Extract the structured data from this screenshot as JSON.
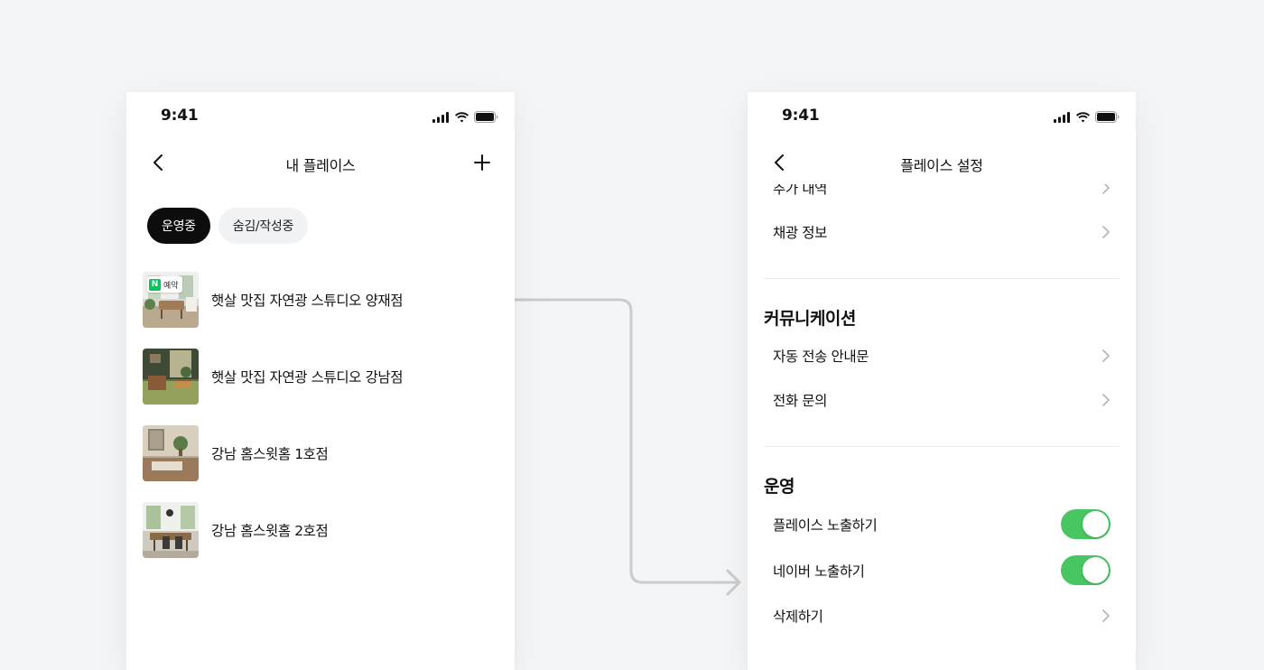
{
  "colors": {
    "background": "#f3f5f7",
    "toggle_on": "#48c662",
    "naver_green": "#03c75a",
    "connector": "#c8c8c8"
  },
  "left_screen": {
    "status_time": "9:41",
    "nav": {
      "back_icon": "chevron-left-icon",
      "title": "내 플레이스",
      "add_icon": "plus-icon"
    },
    "tabs": [
      {
        "label": "운영중",
        "active": true
      },
      {
        "label": "숨김/작성중",
        "active": false
      }
    ],
    "places": [
      {
        "name": "햇살 맛집 자연광 스튜디오 양재점",
        "badge_logo": "N",
        "badge_label": "예약"
      },
      {
        "name": "햇살 맛집 자연광 스튜디오 강남점"
      },
      {
        "name": "강남 홈스윗홈 1호점"
      },
      {
        "name": "강남 홈스윗홈 2호점"
      }
    ]
  },
  "right_screen": {
    "status_time": "9:41",
    "nav": {
      "back_icon": "chevron-left-icon",
      "title": "플레이스 설정"
    },
    "top_rows": [
      {
        "label": "추가 내역"
      },
      {
        "label": "채광 정보"
      }
    ],
    "sections": [
      {
        "title": "커뮤니케이션",
        "rows": [
          {
            "label": "자동 전송 안내문"
          },
          {
            "label": "전화 문의"
          }
        ]
      },
      {
        "title": "운영",
        "rows": [
          {
            "label": "플레이스 노출하기",
            "toggle": true
          },
          {
            "label": "네이버 노출하기",
            "toggle": true
          },
          {
            "label": "삭제하기"
          }
        ]
      }
    ]
  }
}
